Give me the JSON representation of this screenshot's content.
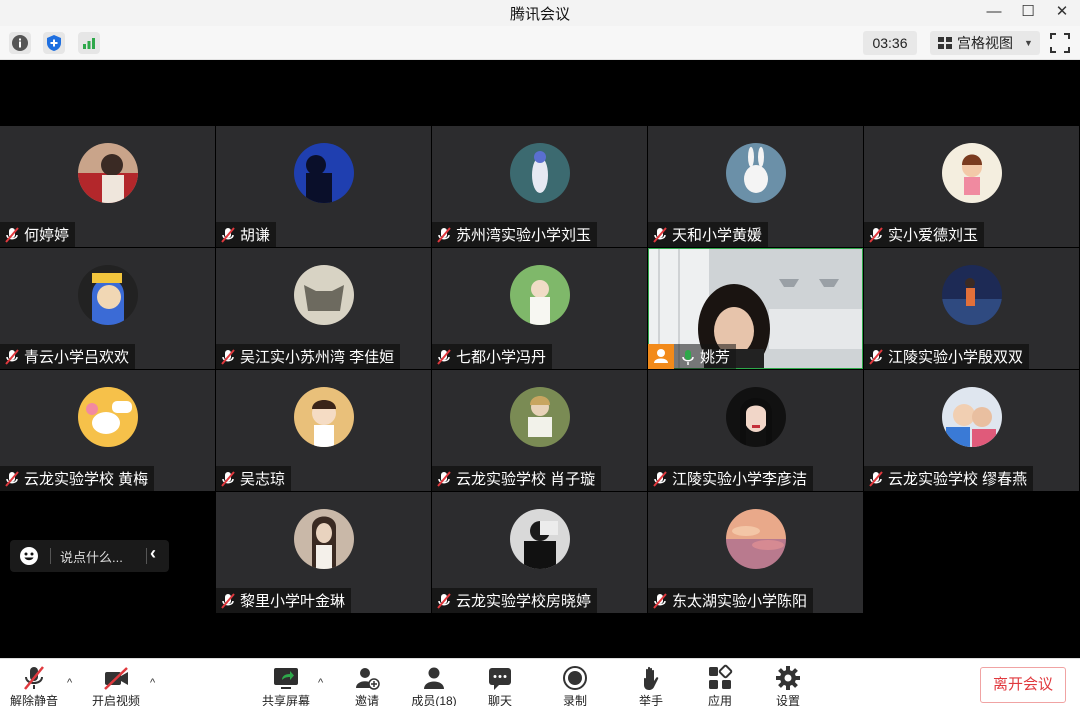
{
  "window": {
    "title": "腾讯会议",
    "minimize": "—",
    "maximize": "☐",
    "close": "✕"
  },
  "toolbar": {
    "timer": "03:36",
    "view_label": "宫格视图",
    "view_caret": "▼"
  },
  "participants": [
    {
      "name": "何婷婷",
      "muted": true
    },
    {
      "name": "胡谦",
      "muted": true
    },
    {
      "name": "苏州湾实验小学刘玉",
      "muted": true
    },
    {
      "name": "天和小学黄媛",
      "muted": true
    },
    {
      "name": "实小爱德刘玉",
      "muted": true
    },
    {
      "name": "青云小学吕欢欢",
      "muted": true
    },
    {
      "name": "吴江实小苏州湾 李佳姮",
      "muted": true
    },
    {
      "name": "七都小学冯丹",
      "muted": true
    },
    {
      "name": "姚芳",
      "muted": false,
      "speaking": true
    },
    {
      "name": "江陵实验小学殷双双",
      "muted": true
    },
    {
      "name": "云龙实验学校 黄梅",
      "muted": true
    },
    {
      "name": "吴志琼",
      "muted": true
    },
    {
      "name": "云龙实验学校 肖子璇",
      "muted": true
    },
    {
      "name": "江陵实验小学李彦洁",
      "muted": true
    },
    {
      "name": "云龙实验学校 缪春燕",
      "muted": true
    },
    {
      "name": "黎里小学叶金琳",
      "muted": true
    },
    {
      "name": "云龙实验学校房晓婷",
      "muted": true
    },
    {
      "name": "东太湖实验小学陈阳",
      "muted": true
    }
  ],
  "chat": {
    "placeholder": "说点什么...",
    "collapse": "‹"
  },
  "controls": {
    "unmute": "解除静音",
    "start_video": "开启视频",
    "share_screen": "共享屏幕",
    "invite": "邀请",
    "members": "成员(18)",
    "chat": "聊天",
    "record": "录制",
    "raise_hand": "举手",
    "apps": "应用",
    "settings": "设置",
    "leave": "离开会议",
    "caret": "^"
  },
  "colors": {
    "accent_green": "#2ea84a",
    "leave_red": "#e0393e",
    "speaker_badge": "#f28a1a",
    "tile_bg": "#2c2c2e"
  }
}
